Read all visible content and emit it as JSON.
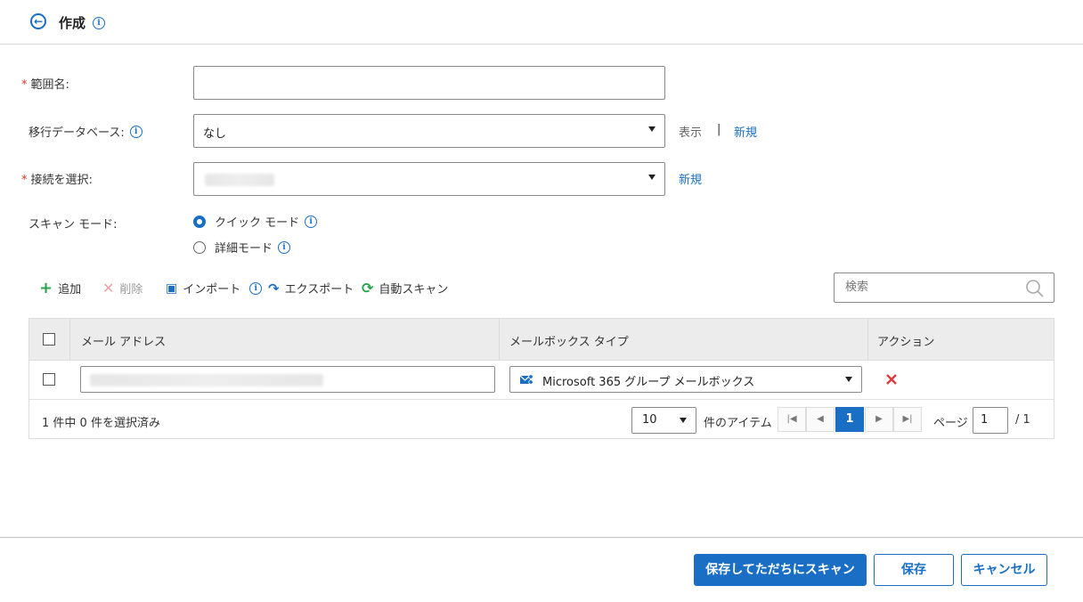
{
  "header": {
    "title": "作成"
  },
  "form": {
    "scope_name_label": "範囲名:",
    "scope_name_value": "",
    "migration_db_label": "移行データベース:",
    "migration_db_value": "なし",
    "migration_db_view_link": "表示",
    "migration_db_separator": "|",
    "migration_db_new_link": "新規",
    "connection_label": "接続を選択:",
    "connection_new_link": "新規",
    "scan_mode_label": "スキャン モード:",
    "scan_mode_quick": "クイック モード",
    "scan_mode_detail": "詳細モード",
    "scan_mode_selected": "quick",
    "required_mark": "*"
  },
  "toolbar": {
    "add": "追加",
    "delete": "削除",
    "import": "インポート",
    "export": "エクスポート",
    "auto_scan": "自動スキャン",
    "search_placeholder": "検索"
  },
  "table": {
    "columns": [
      "メール アドレス",
      "メールボックス タイプ",
      "アクション"
    ],
    "rows": [
      {
        "email": "",
        "mailbox_type": "Microsoft 365 グループ メールボックス"
      }
    ]
  },
  "pager": {
    "summary": "1 件中 0 件を選択済み",
    "page_size": "10",
    "items_label": "件のアイテム",
    "current_page": "1",
    "page_label": "ページ",
    "page_input": "1",
    "total_pages": "/ 1"
  },
  "footer": {
    "save_and_scan": "保存してただちにスキャン",
    "save": "保存",
    "cancel": "キャンセル"
  },
  "colors": {
    "accent": "#1a6fc4",
    "required": "#d9342b",
    "delete_disabled": "#e8a3a3",
    "action_delete": "#e03b3b"
  }
}
